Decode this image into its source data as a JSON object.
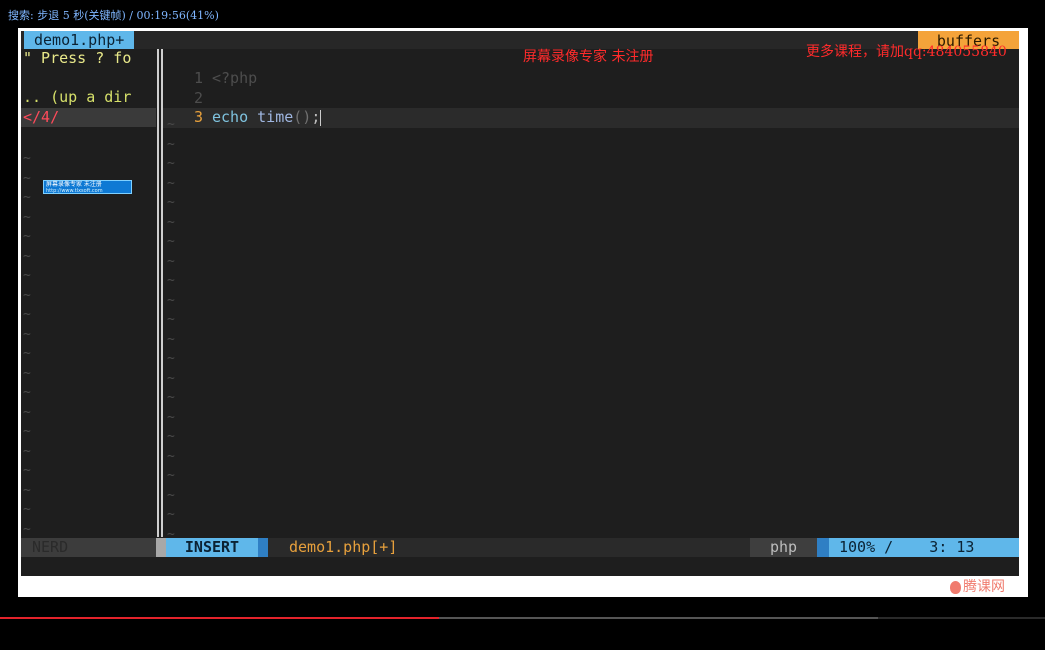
{
  "player": {
    "osd_text": "搜索: 步退 5 秒(关键帧) / 00:19:56(41%)",
    "progress_fraction": 0.42,
    "buffered_fraction": 0.84
  },
  "watermarks": {
    "recorder": "屏幕录像专家 未注册",
    "promo": "更多课程，请加qq:484055840",
    "badge_line1": "屏幕录像专家      未注册",
    "badge_line2": "http://www.tlxsoft.com",
    "logo": "腾课网"
  },
  "vim": {
    "tab_active": "demo1.php+",
    "tab_right": "buffers",
    "nerdtree": {
      "help_line": "\" Press ? fo",
      "updir_line": ".. (up a dir",
      "current_dir": "</4/",
      "tilde": "~"
    },
    "editor": {
      "lines": [
        {
          "num": "1",
          "tag": "<?php"
        },
        {
          "num": "2",
          "text": ""
        },
        {
          "num": "3",
          "kw": "echo",
          "fn": "time",
          "paren": "()",
          "semi": ";"
        }
      ],
      "tilde": "~"
    },
    "statusline": {
      "nerd_label": "NERD",
      "mode": "INSERT",
      "file": "demo1.php[+]",
      "filetype": "php",
      "position": "100% /    3: 13"
    }
  },
  "colors": {
    "accent_blue": "#5fb7ea",
    "accent_orange": "#e7a03c",
    "background": "#1e1e1e",
    "watermark_red": "#ff2b2b",
    "progress_red": "#e3232b"
  }
}
